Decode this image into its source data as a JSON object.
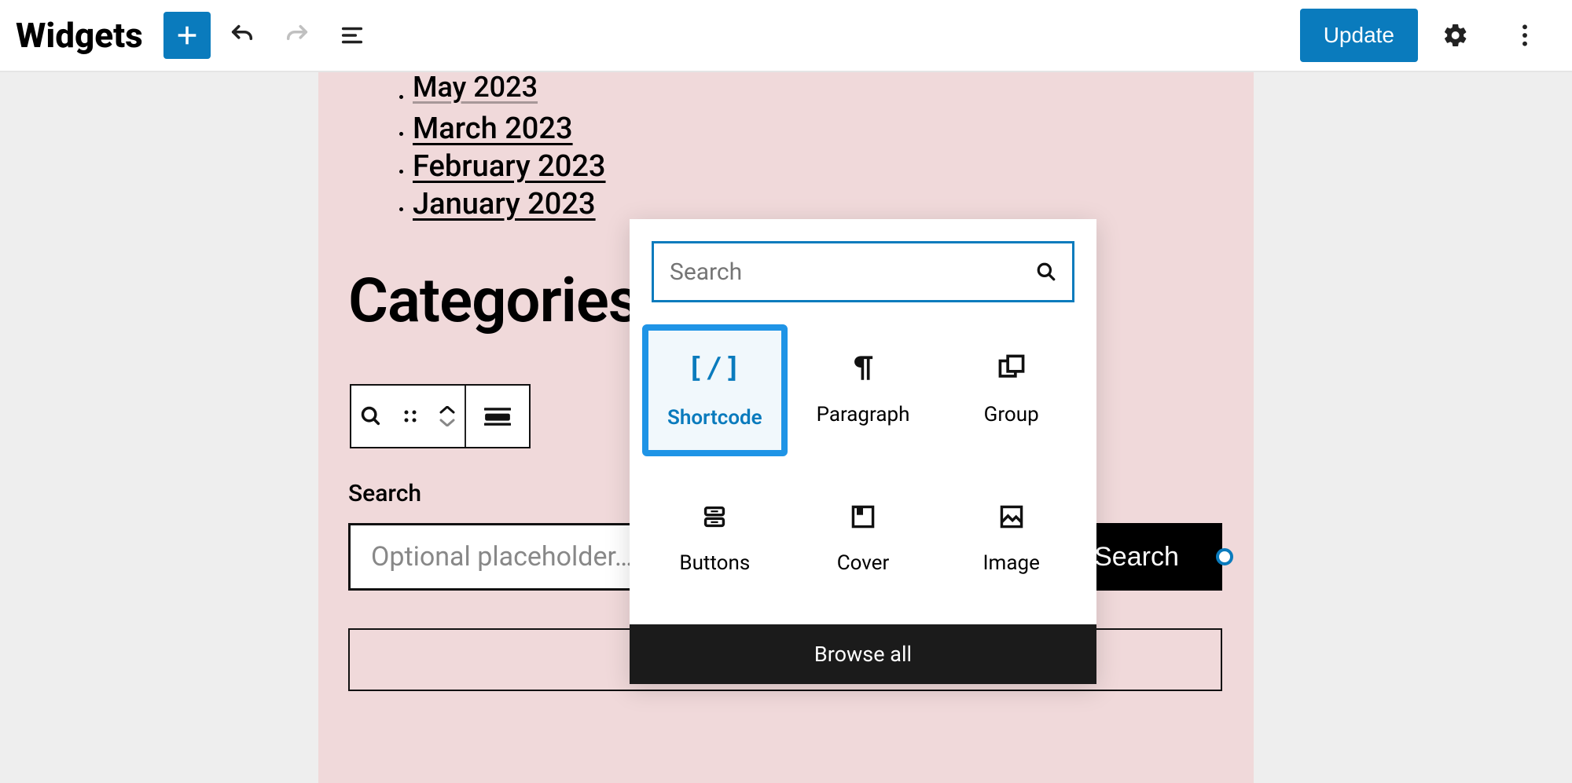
{
  "header": {
    "title": "Widgets",
    "update_label": "Update"
  },
  "archives": {
    "items": [
      {
        "label": "May 2023"
      },
      {
        "label": "March 2023"
      },
      {
        "label": "February 2023"
      },
      {
        "label": "January 2023"
      }
    ]
  },
  "categories_heading": "Categories",
  "search_block": {
    "label": "Search",
    "placeholder": "Optional placeholder…",
    "button_label": "Search"
  },
  "inserter": {
    "search_placeholder": "Search",
    "browse_label": "Browse all",
    "items": [
      {
        "label": "Shortcode",
        "icon": "shortcode-icon",
        "selected": true
      },
      {
        "label": "Paragraph",
        "icon": "paragraph-icon"
      },
      {
        "label": "Group",
        "icon": "group-icon"
      },
      {
        "label": "Buttons",
        "icon": "buttons-icon"
      },
      {
        "label": "Cover",
        "icon": "cover-icon"
      },
      {
        "label": "Image",
        "icon": "image-icon"
      }
    ]
  }
}
